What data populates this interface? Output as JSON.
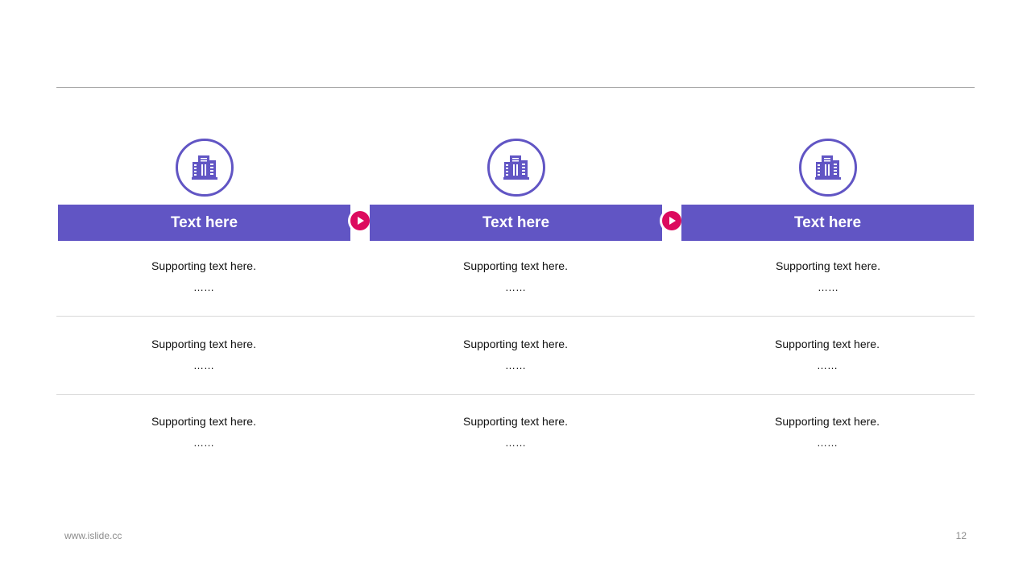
{
  "columns": [
    {
      "title": "Text here",
      "icon": "building-icon"
    },
    {
      "title": "Text here",
      "icon": "building-icon"
    },
    {
      "title": "Text here",
      "icon": "building-icon"
    }
  ],
  "rows": [
    [
      {
        "text": "Supporting  text here.",
        "ellipsis": "……"
      },
      {
        "text": "Supporting  text here.",
        "ellipsis": "……"
      },
      {
        "text": "Supporting  text here.",
        "ellipsis": "……"
      }
    ],
    [
      {
        "text": "Supporting  text here.",
        "ellipsis": "……"
      },
      {
        "text": "Supporting  text here.",
        "ellipsis": "……"
      },
      {
        "text": "Supporting  text here.",
        "ellipsis": "……"
      }
    ],
    [
      {
        "text": "Supporting  text here.",
        "ellipsis": "……"
      },
      {
        "text": "Supporting  text here.",
        "ellipsis": "……"
      },
      {
        "text": "Supporting  text here.",
        "ellipsis": "……"
      }
    ]
  ],
  "footer": {
    "website": "www.islide.cc",
    "page_number": "12"
  },
  "colors": {
    "accent": "#6155c4",
    "arrow": "#dc0a5e"
  }
}
